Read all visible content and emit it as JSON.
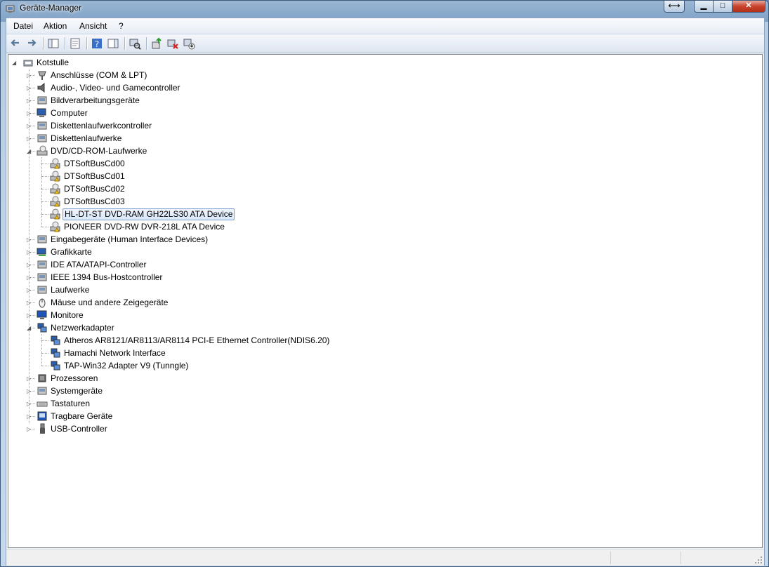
{
  "window": {
    "title": "Geräte-Manager"
  },
  "menu": [
    "Datei",
    "Aktion",
    "Ansicht",
    "?"
  ],
  "toolbar": [
    {
      "name": "back-icon"
    },
    {
      "name": "forward-icon"
    },
    {
      "sep": true
    },
    {
      "name": "show-hide-console-tree-icon"
    },
    {
      "sep": true
    },
    {
      "name": "properties-icon"
    },
    {
      "sep": true
    },
    {
      "name": "help-icon"
    },
    {
      "name": "action-pane-icon"
    },
    {
      "sep": true
    },
    {
      "name": "scan-hardware-changes-icon"
    },
    {
      "sep": true
    },
    {
      "name": "update-driver-icon"
    },
    {
      "name": "uninstall-icon"
    },
    {
      "name": "disable-device-icon"
    }
  ],
  "tree": {
    "root": "Kotstulle",
    "categories": [
      {
        "label": "Anschlüsse (COM & LPT)",
        "icon": "port-icon"
      },
      {
        "label": "Audio-, Video- und Gamecontroller",
        "icon": "audio-icon"
      },
      {
        "label": "Bildverarbeitungsgeräte",
        "icon": "imaging-icon"
      },
      {
        "label": "Computer",
        "icon": "computer-icon"
      },
      {
        "label": "Diskettenlaufwerkcontroller",
        "icon": "floppy-controller-icon"
      },
      {
        "label": "Diskettenlaufwerke",
        "icon": "floppy-drive-icon"
      },
      {
        "label": "DVD/CD-ROM-Laufwerke",
        "icon": "dvd-icon",
        "expanded": true,
        "children": [
          {
            "label": "DTSoftBusCd00"
          },
          {
            "label": "DTSoftBusCd01"
          },
          {
            "label": "DTSoftBusCd02"
          },
          {
            "label": "DTSoftBusCd03"
          },
          {
            "label": "HL-DT-ST DVD-RAM GH22LS30 ATA Device",
            "selected": true
          },
          {
            "label": "PIONEER DVD-RW  DVR-218L ATA Device"
          }
        ]
      },
      {
        "label": "Eingabegeräte (Human Interface Devices)",
        "icon": "hid-icon"
      },
      {
        "label": "Grafikkarte",
        "icon": "display-adapter-icon"
      },
      {
        "label": "IDE ATA/ATAPI-Controller",
        "icon": "ide-controller-icon"
      },
      {
        "label": "IEEE 1394 Bus-Hostcontroller",
        "icon": "firewire-icon"
      },
      {
        "label": "Laufwerke",
        "icon": "disk-drive-icon"
      },
      {
        "label": "Mäuse und andere Zeigegeräte",
        "icon": "mouse-icon"
      },
      {
        "label": "Monitore",
        "icon": "monitor-icon"
      },
      {
        "label": "Netzwerkadapter",
        "icon": "network-adapter-icon",
        "expanded": true,
        "children": [
          {
            "label": "Atheros AR8121/AR8113/AR8114 PCI-E Ethernet Controller(NDIS6.20)"
          },
          {
            "label": "Hamachi Network Interface"
          },
          {
            "label": "TAP-Win32 Adapter V9 (Tunngle)"
          }
        ]
      },
      {
        "label": "Prozessoren",
        "icon": "processor-icon"
      },
      {
        "label": "Systemgeräte",
        "icon": "system-devices-icon"
      },
      {
        "label": "Tastaturen",
        "icon": "keyboard-icon"
      },
      {
        "label": "Tragbare Geräte",
        "icon": "portable-devices-icon"
      },
      {
        "label": "USB-Controller",
        "icon": "usb-icon"
      }
    ]
  }
}
